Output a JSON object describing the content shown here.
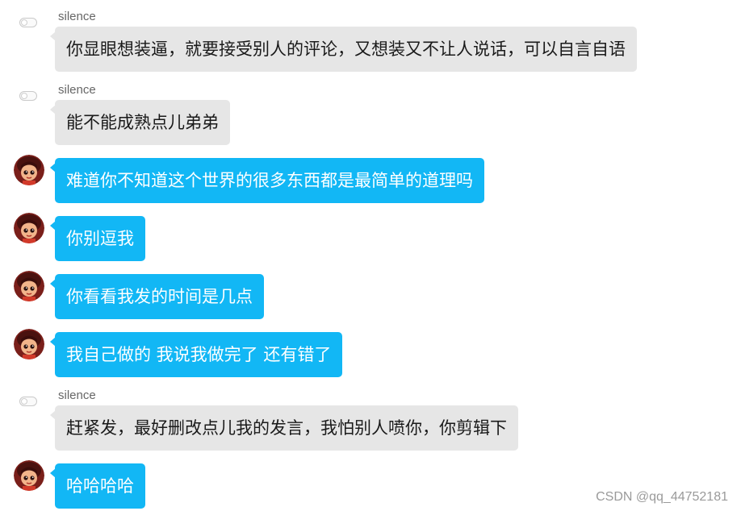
{
  "messages": [
    {
      "role": "other",
      "sender": "silence",
      "text": "你显眼想装逼，就要接受别人的评论，又想装又不让人说话，可以自言自语",
      "avatar_icon": "toggle-avatar-icon"
    },
    {
      "role": "other",
      "sender": "silence",
      "text": "能不能成熟点儿弟弟",
      "avatar_icon": "toggle-avatar-icon"
    },
    {
      "role": "self",
      "text": "难道你不知道这个世界的很多东西都是最简单的道理吗",
      "avatar_icon": "cartoon-girl-avatar-icon"
    },
    {
      "role": "self",
      "text": "你别逗我",
      "avatar_icon": "cartoon-girl-avatar-icon"
    },
    {
      "role": "self",
      "text": "你看看我发的时间是几点",
      "avatar_icon": "cartoon-girl-avatar-icon"
    },
    {
      "role": "self",
      "text": "我自己做的 我说我做完了 还有错了",
      "avatar_icon": "cartoon-girl-avatar-icon"
    },
    {
      "role": "other",
      "sender": "silence",
      "text": "赶紧发，最好删改点儿我的发言，我怕别人喷你，你剪辑下",
      "avatar_icon": "toggle-avatar-icon"
    },
    {
      "role": "self",
      "text": "哈哈哈哈",
      "avatar_icon": "cartoon-girl-avatar-icon"
    }
  ],
  "watermark": "CSDN @qq_44752181",
  "colors": {
    "self_bubble": "#12b7f5",
    "other_bubble": "#e6e6e6",
    "sender_name": "#666666",
    "watermark": "#9a9a9a"
  }
}
